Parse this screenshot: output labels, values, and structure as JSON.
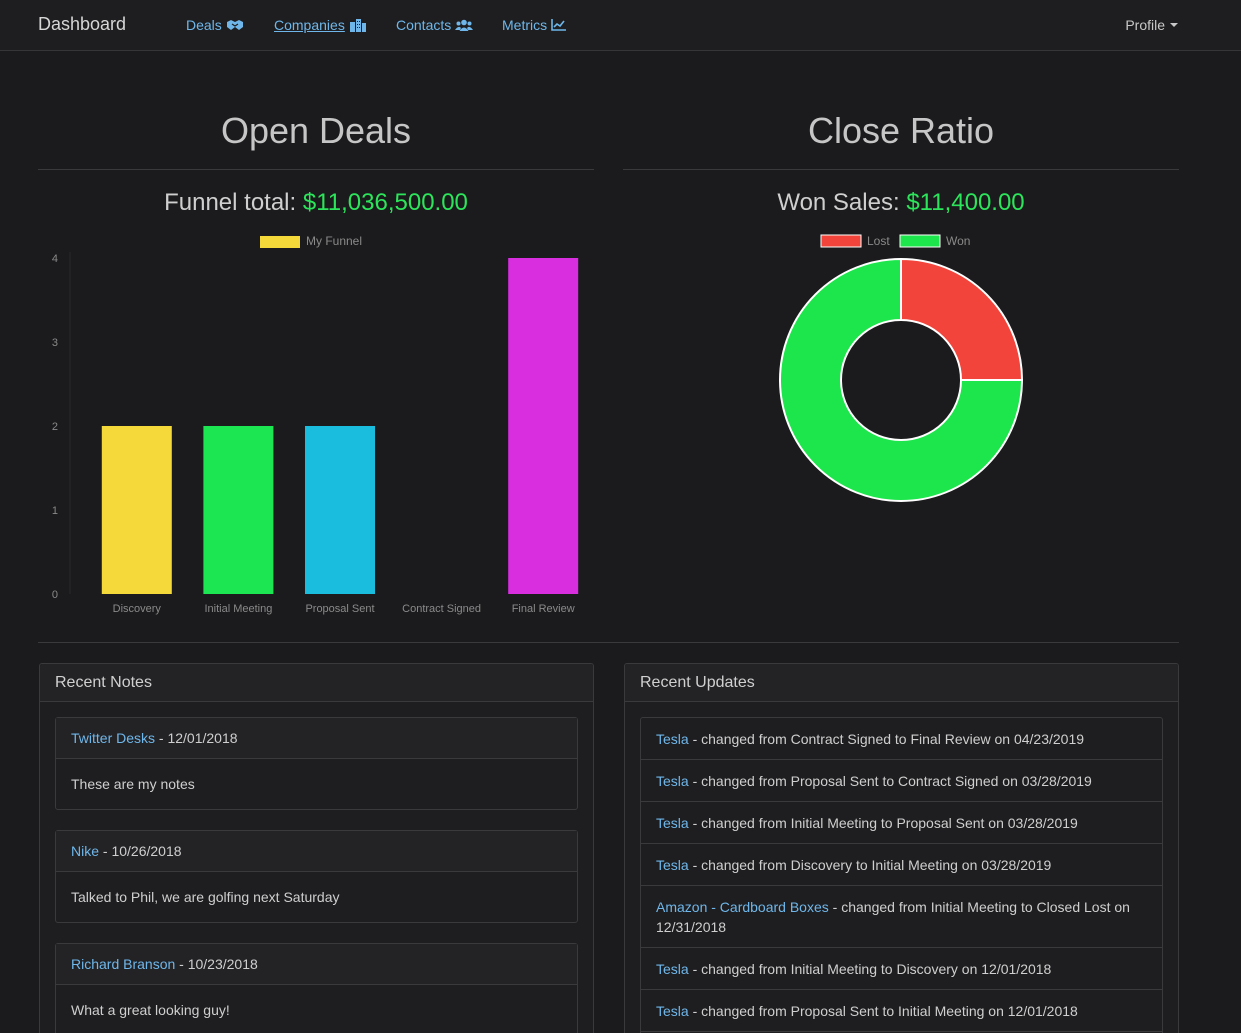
{
  "nav": {
    "brand": "Dashboard",
    "items": [
      {
        "label": "Deals",
        "icon": "handshake-icon"
      },
      {
        "label": "Companies",
        "icon": "building-icon"
      },
      {
        "label": "Contacts",
        "icon": "users-icon"
      },
      {
        "label": "Metrics",
        "icon": "chart-line-icon"
      }
    ],
    "profile": "Profile"
  },
  "open_deals": {
    "title": "Open Deals",
    "total_label": "Funnel total:",
    "total_value": "$11,036,500.00"
  },
  "close_ratio": {
    "title": "Close Ratio",
    "total_label": "Won Sales:",
    "total_value": "$11,400.00"
  },
  "chart_data": [
    {
      "type": "bar",
      "legend": [
        "My Funnel"
      ],
      "categories": [
        "Discovery",
        "Initial Meeting",
        "Proposal Sent",
        "Contract Signed",
        "Final Review"
      ],
      "values": [
        2,
        2,
        2,
        0,
        4
      ],
      "colors": [
        "#f5d93b",
        "#1ce651",
        "#1bbddf",
        "#1b1b1d",
        "#d82ee0"
      ],
      "ylim": [
        0,
        4
      ],
      "yticks": [
        "0",
        "1",
        "2",
        "3",
        "4"
      ]
    },
    {
      "type": "pie",
      "legend": [
        "Lost",
        "Won"
      ],
      "labels": [
        "Lost",
        "Won"
      ],
      "values": [
        1,
        3
      ],
      "colors": [
        "#f2443a",
        "#1ce64b"
      ]
    }
  ],
  "recent_notes": {
    "heading": "Recent Notes",
    "notes": [
      {
        "link": "Twitter Desks",
        "date": " - 12/01/2018",
        "body": "These are my notes"
      },
      {
        "link": "Nike",
        "date": " - 10/26/2018",
        "body": "Talked to Phil, we are golfing next Saturday"
      },
      {
        "link": "Richard Branson",
        "date": " - 10/23/2018",
        "body": "What a great looking guy!"
      }
    ]
  },
  "recent_updates": {
    "heading": "Recent Updates",
    "items": [
      {
        "link": "Tesla",
        "text": " - changed from Contract Signed to Final Review on 04/23/2019"
      },
      {
        "link": "Tesla",
        "text": " - changed from Proposal Sent to Contract Signed on 03/28/2019"
      },
      {
        "link": "Tesla",
        "text": " - changed from Initial Meeting to Proposal Sent on 03/28/2019"
      },
      {
        "link": "Tesla",
        "text": " - changed from Discovery to Initial Meeting on 03/28/2019"
      },
      {
        "link": "Amazon - Cardboard Boxes",
        "text": " - changed from Initial Meeting to Closed Lost on 12/31/2018"
      },
      {
        "link": "Tesla",
        "text": " - changed from Initial Meeting to Discovery on 12/01/2018"
      },
      {
        "link": "Tesla",
        "text": " - changed from Proposal Sent to Initial Meeting on 12/01/2018"
      },
      {
        "link": "",
        "text": ""
      }
    ]
  }
}
